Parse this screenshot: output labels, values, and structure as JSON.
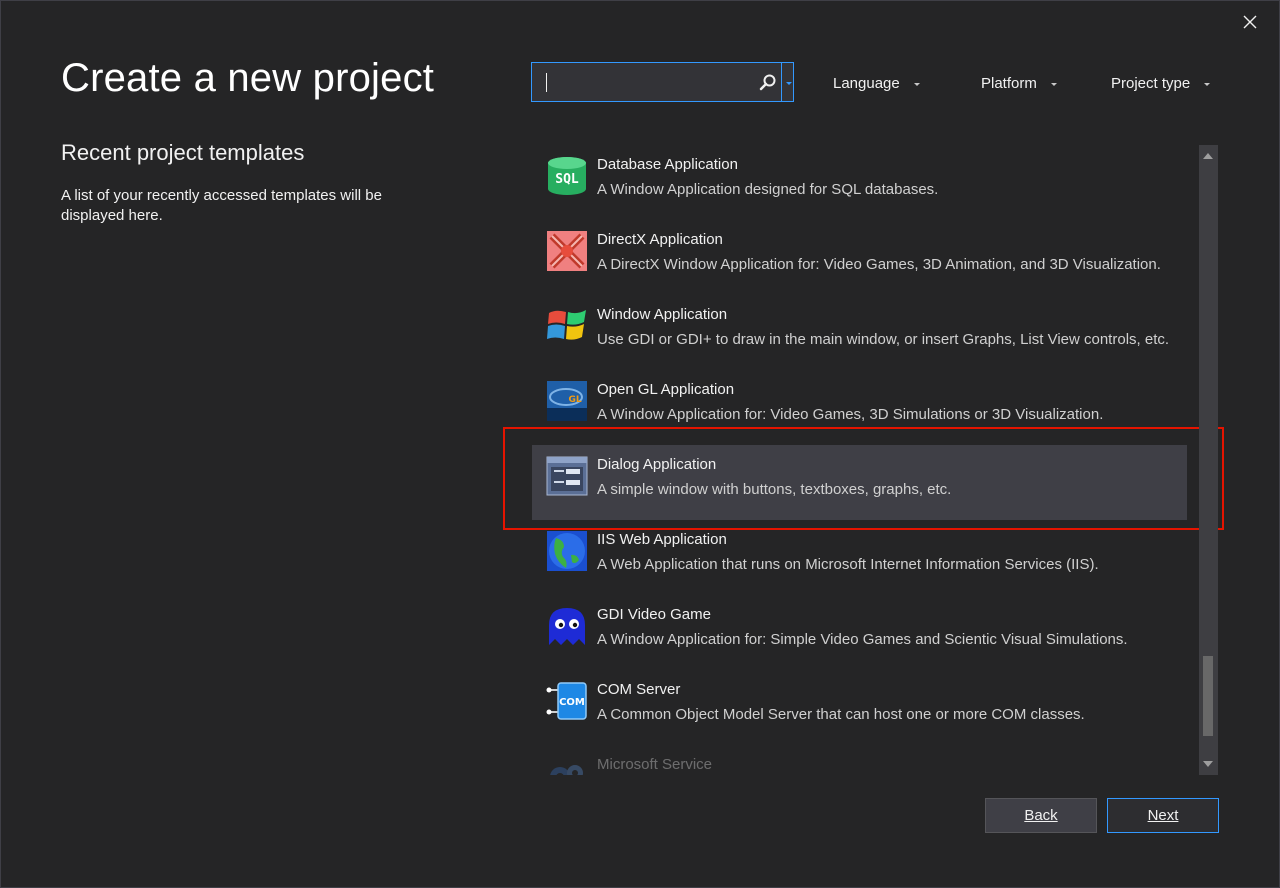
{
  "dialog": {
    "title": "Create a new project",
    "close_glyph": "✕"
  },
  "recent": {
    "title": "Recent project templates",
    "description": "A list of your recently accessed templates will be displayed here."
  },
  "search": {
    "value": "",
    "placeholder": ""
  },
  "filters": {
    "language": "Language",
    "platform": "Platform",
    "project_type": "Project type"
  },
  "templates": [
    {
      "name": "Database Application",
      "description": "A Window Application designed for SQL databases.",
      "icon": "sql-database-icon"
    },
    {
      "name": "DirectX Application",
      "description": "A DirectX Window Application for: Video Games, 3D Animation, and 3D Visualization.",
      "icon": "directx-icon"
    },
    {
      "name": "Window Application",
      "description": "Use GDI or GDI+ to draw in the main window, or insert Graphs, List View controls, etc.",
      "icon": "windows-logo-icon"
    },
    {
      "name": "Open GL Application",
      "description": "A Window Application for: Video Games, 3D Simulations or 3D Visualization.",
      "icon": "opengl-icon"
    },
    {
      "name": "Dialog Application",
      "description": "A simple window with buttons, textboxes, graphs, etc.",
      "icon": "dialog-window-icon",
      "selected": true
    },
    {
      "name": "IIS Web Application",
      "description": "A Web Application that runs on Microsoft Internet Information Services (IIS).",
      "icon": "globe-icon"
    },
    {
      "name": "GDI Video Game",
      "description": "A Window Application for: Simple Video Games and Scientic Visual Simulations.",
      "icon": "ghost-icon"
    },
    {
      "name": "COM Server",
      "description": "A Common Object Model Server that can host one or more COM classes.",
      "icon": "com-server-icon"
    },
    {
      "name": "Microsoft Service",
      "description": "",
      "icon": "gears-icon"
    }
  ],
  "buttons": {
    "back": "Back",
    "next": "Next"
  },
  "colors": {
    "accent": "#3399ff",
    "highlight_box": "#e51400",
    "background": "#252526",
    "selected_row": "#3f3f46"
  }
}
